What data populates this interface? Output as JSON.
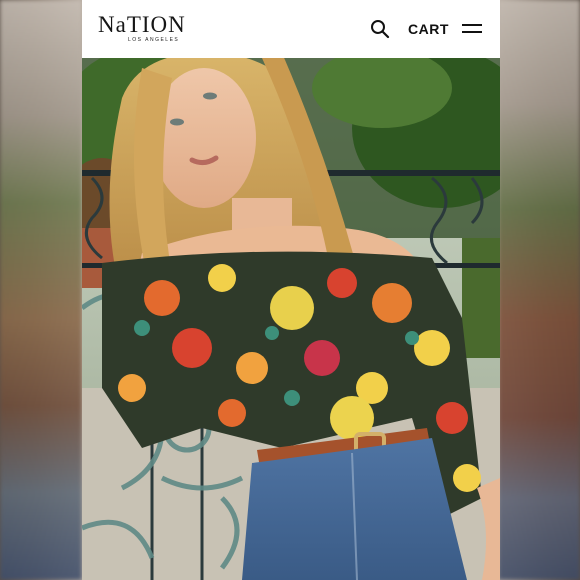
{
  "header": {
    "logo_text": "NaTION",
    "logo_subtext": "LOS ANGELES",
    "search_icon": "search-icon",
    "cart_label": "CART",
    "menu_icon": "hamburger-menu-icon"
  },
  "main": {
    "image_subject": "model in off-shoulder floral top and belted denim on a balcony"
  },
  "colors": {
    "header_bg": "#ffffff",
    "text": "#111111"
  }
}
